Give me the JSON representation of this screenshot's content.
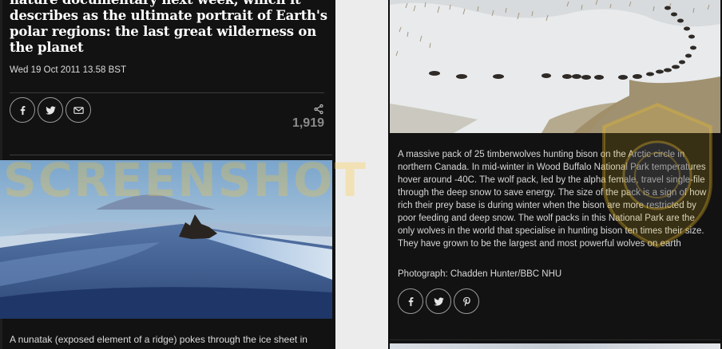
{
  "left": {
    "headline": "nature documentary next week, which it describes as the ultimate portrait of Earth's polar regions: the last great wilderness on the planet",
    "date": "Wed 19 Oct 2011 13.58 BST",
    "share_count": "1,919",
    "caption": "A nunatak (exposed element of a ridge) pokes through the ice sheet in"
  },
  "right": {
    "caption": "A massive pack of 25 timberwolves hunting bison on the Arctic circle in northern Canada. In mid-winter in Wood Buffalo National Park temperatures hover around -40C. The wolf pack, led by the alpha female, travel single-file through the deep snow to save energy. The size of the pack is a sign of how rich their prey base is during winter when the bison are more restricted by poor feeding and deep snow. The wolf packs in this National Park are the only wolves in the world that specialise in hunting bison ten times their size. They have grown to be the largest and most powerful wolves on earth",
    "credit": "Photograph: Chadden Hunter/BBC NHU"
  },
  "icons": [
    "facebook-icon",
    "twitter-icon",
    "email-icon",
    "share-icon",
    "pinterest-icon"
  ],
  "watermark": "SCREENSHOT",
  "colors": {
    "background": "#121212",
    "text": "#dcdcdc",
    "share_count": "#8a8a8a"
  }
}
